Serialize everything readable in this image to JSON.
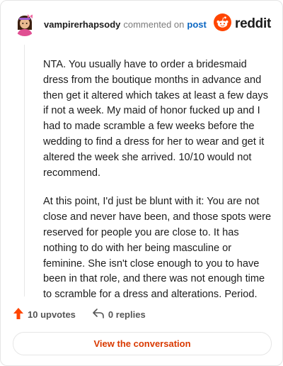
{
  "comment": {
    "username": "vampirerhapsody",
    "action_text": "commented on",
    "post_link": "post",
    "paragraphs": [
      "NTA. You usually have to order a bridesmaid dress from the boutique months in advance and then get it altered which takes at least a few days if not a week. My maid of honor fucked up and I had to made scramble a few weeks before the wedding to find a dress for her to wear and get it altered the week she arrived. 10/10 would not recommend.",
      "At this point, I'd just be blunt with it: You are not close and never have been, and those spots were reserved for people you are close to. It has nothing to do with her being masculine or feminine. She isn't close enough to you to have been in that role, and there was not enough time to scramble for a dress and alterations. Period."
    ]
  },
  "brand": {
    "name": "reddit",
    "accent": "#ff4500"
  },
  "footer": {
    "upvotes": "10 upvotes",
    "replies": "0 replies"
  },
  "cta": {
    "label": "View the conversation"
  },
  "icons": {
    "avatar": "avatar-icon",
    "logo": "reddit-logo-icon",
    "upvote": "upvote-arrow-icon",
    "reply": "reply-arrow-icon"
  }
}
